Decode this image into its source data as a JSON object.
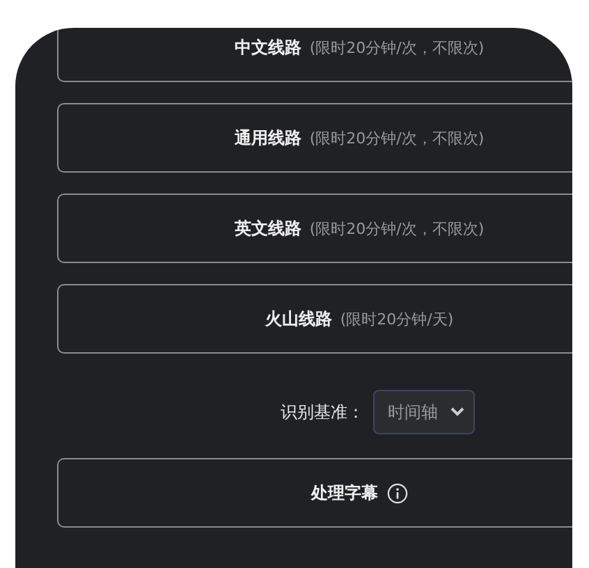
{
  "routes": [
    {
      "label": "中文线路",
      "hint": "(限时20分钟/次，不限次)"
    },
    {
      "label": "通用线路",
      "hint": "(限时20分钟/次，不限次)"
    },
    {
      "label": "英文线路",
      "hint": "(限时20分钟/次，不限次)"
    },
    {
      "label": "火山线路",
      "hint": "(限时20分钟/天)"
    }
  ],
  "basis": {
    "label": "识别基准：",
    "value": "时间轴"
  },
  "process_button": {
    "label": "处理字幕"
  }
}
